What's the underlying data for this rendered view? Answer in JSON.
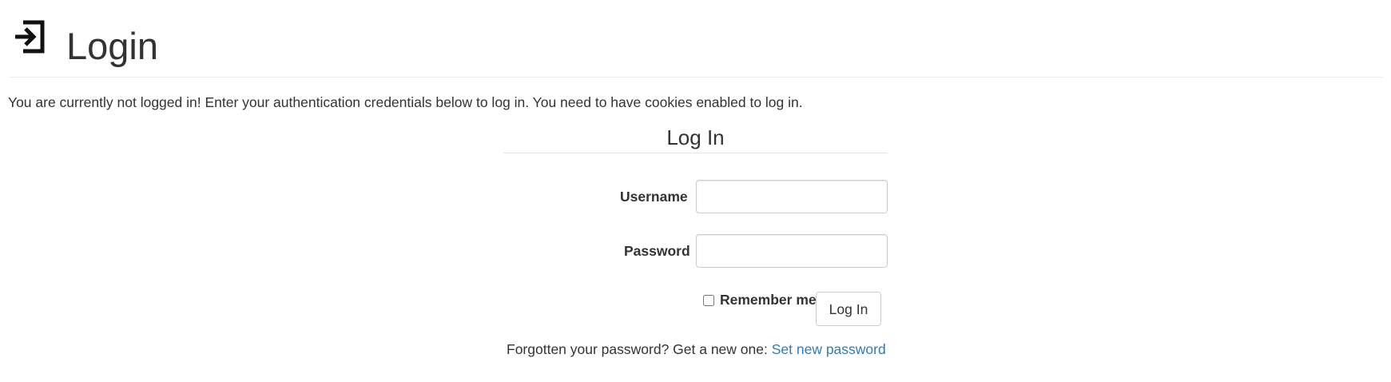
{
  "header": {
    "icon": "login-icon",
    "title": "Login"
  },
  "intro": {
    "text": "You are currently not logged in! Enter your authentication credentials below to log in. You need to have cookies enabled to log in."
  },
  "form": {
    "legend": "Log In",
    "username": {
      "label": "Username",
      "value": "",
      "placeholder": ""
    },
    "password": {
      "label": "Password",
      "value": "",
      "placeholder": ""
    },
    "remember": {
      "label": "Remember me",
      "checked": false
    },
    "submit_label": "Log In"
  },
  "forgot": {
    "text": "Forgotten your password? Get a new one: ",
    "link_label": "Set new password"
  },
  "colors": {
    "text": "#333333",
    "link": "#337ab7",
    "border": "#cccccc",
    "divider": "#eeeeee"
  }
}
